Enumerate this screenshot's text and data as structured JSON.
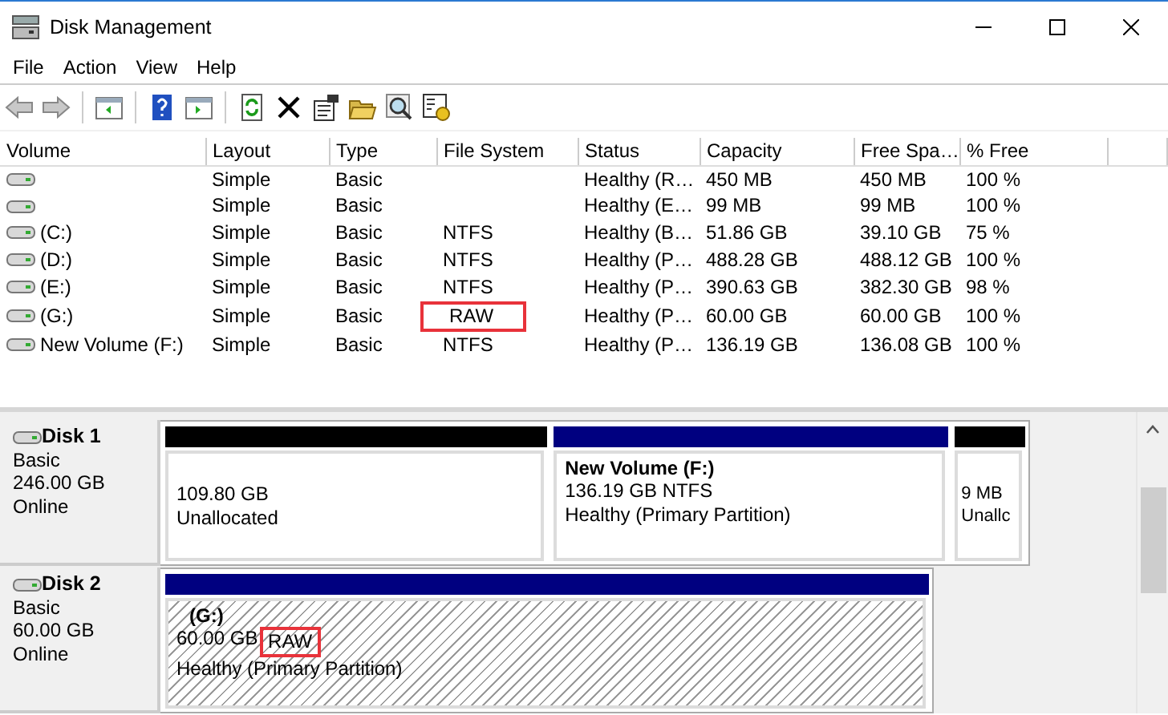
{
  "window": {
    "title": "Disk Management"
  },
  "menu": [
    "File",
    "Action",
    "View",
    "Help"
  ],
  "toolbar": [
    {
      "kind": "back",
      "disabled": true
    },
    {
      "kind": "forward",
      "disabled": true
    },
    {
      "kind": "separator"
    },
    {
      "kind": "tree"
    },
    {
      "kind": "separator"
    },
    {
      "kind": "help"
    },
    {
      "kind": "pane"
    },
    {
      "kind": "separator"
    },
    {
      "kind": "refresh"
    },
    {
      "kind": "delete"
    },
    {
      "kind": "properties"
    },
    {
      "kind": "open"
    },
    {
      "kind": "find"
    },
    {
      "kind": "settings"
    }
  ],
  "table": {
    "columns": [
      "Volume",
      "Layout",
      "Type",
      "File System",
      "Status",
      "Capacity",
      "Free Spa…",
      "% Free"
    ],
    "rows": [
      {
        "layout": "Simple",
        "type": "Basic",
        "status": "Healthy (R…",
        "capacity": "450 MB",
        "free": "450 MB",
        "pct": "100 %"
      },
      {
        "layout": "Simple",
        "type": "Basic",
        "status": "Healthy (E…",
        "capacity": "99 MB",
        "free": "99 MB",
        "pct": "100 %"
      },
      {
        "volume": "(C:)",
        "layout": "Simple",
        "type": "Basic",
        "fs": "NTFS",
        "status": "Healthy (B…",
        "capacity": "51.86 GB",
        "free": "39.10 GB",
        "pct": "75 %"
      },
      {
        "volume": "(D:)",
        "layout": "Simple",
        "type": "Basic",
        "fs": "NTFS",
        "status": "Healthy (P…",
        "capacity": "488.28 GB",
        "free": "488.12 GB",
        "pct": "100 %"
      },
      {
        "volume": "(E:)",
        "layout": "Simple",
        "type": "Basic",
        "fs": "NTFS",
        "status": "Healthy (P…",
        "capacity": "390.63 GB",
        "free": "382.30 GB",
        "pct": "98 %"
      },
      {
        "volume": "(G:)",
        "layout": "Simple",
        "type": "Basic",
        "fs": "RAW",
        "status": "Healthy (P…",
        "capacity": "60.00 GB",
        "free": "60.00 GB",
        "pct": "100 %",
        "fs_highlighted": true
      },
      {
        "volume": "New Volume (F:)",
        "layout": "Simple",
        "type": "Basic",
        "fs": "NTFS",
        "status": "Healthy (P…",
        "capacity": "136.19 GB",
        "free": "136.08 GB",
        "pct": "100 %"
      }
    ]
  },
  "disks": [
    {
      "name": "Disk 1",
      "type": "Basic",
      "size": "246.00 GB",
      "status": "Online",
      "partitions": [
        {
          "kind": "unallocated",
          "size": "109.80 GB",
          "status": "Unallocated",
          "selected": false
        },
        {
          "kind": "primary",
          "name": "New Volume  (F:)",
          "size": "136.19 GB",
          "fs": "NTFS",
          "status": "Healthy (Primary Partition)",
          "selected": false
        },
        {
          "kind": "unallocated",
          "size": "9 MB",
          "status": "Unallc",
          "selected": false
        }
      ]
    },
    {
      "name": "Disk 2",
      "type": "Basic",
      "size": "60.00 GB",
      "status": "Online",
      "partitions": [
        {
          "kind": "primary",
          "name": "(G:)",
          "size": "60.00 GB",
          "fs": "RAW",
          "status": "Healthy (Primary Partition)",
          "selected": true,
          "fs_highlighted": true
        }
      ]
    }
  ]
}
